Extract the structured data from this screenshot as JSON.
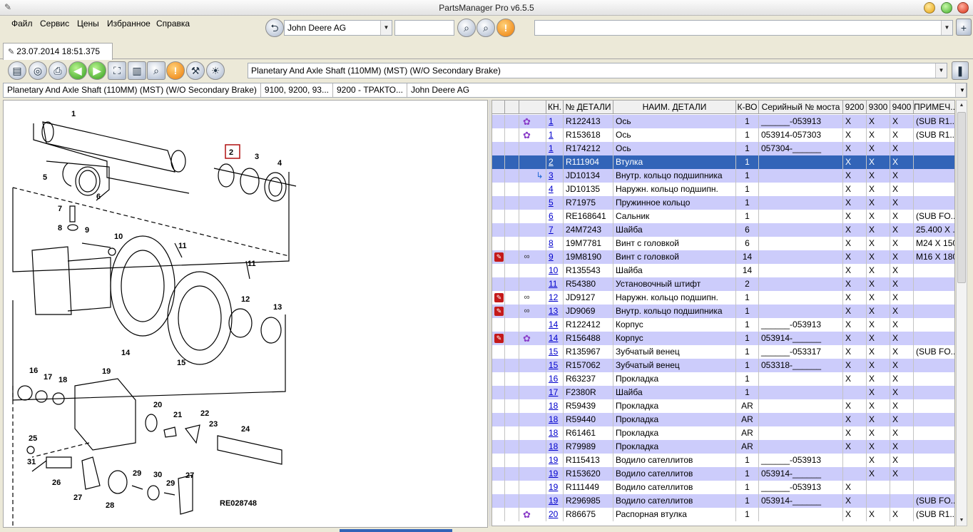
{
  "window": {
    "title": "PartsManager Pro v6.5.5"
  },
  "menu": [
    "Файл",
    "Сервис",
    "Цены",
    "Избранное",
    "Справка"
  ],
  "toolbar": {
    "brand_select": "John Deere AG",
    "search_value": "",
    "filter_value": ""
  },
  "tab": {
    "label": "23.07.2014 18:51.375"
  },
  "section_select": "Planetary And Axle Shaft (110MM) (MST) (W/O Secondary Brake)",
  "breadcrumb": [
    "Planetary And Axle Shaft (110MM) (MST) (W/O Secondary Brake)",
    "9100, 9200, 93...",
    "9200 - ТРАКТО...",
    "John Deere AG"
  ],
  "diagram": {
    "code": "RE028748",
    "highlighted": "2",
    "callouts": [
      "1",
      "2",
      "3",
      "4",
      "5",
      "6",
      "7",
      "8",
      "9",
      "10",
      "11",
      "11",
      "12",
      "13",
      "14",
      "15",
      "16",
      "17",
      "18",
      "19",
      "20",
      "21",
      "22",
      "23",
      "24",
      "25",
      "26",
      "27",
      "27",
      "28",
      "29",
      "29",
      "30",
      "31"
    ]
  },
  "colors": {
    "selection": "#3264b8",
    "alt_row": "#ccccfb",
    "link": "#0000cc",
    "flag": "#c41a1a",
    "gear": "#8a3cc8"
  },
  "grid": {
    "headers": [
      "КН.",
      "№ ДЕТАЛИ",
      "НАИМ. ДЕТАЛИ",
      "К-ВО",
      "Серийный № моста",
      "9200",
      "9300",
      "9400",
      "ПРИМЕЧ..."
    ],
    "rows": [
      {
        "icons": [
          "",
          "gear-icon"
        ],
        "kn": "1",
        "num": "R122413",
        "name": "Ось",
        "qty": "1",
        "serial": "______-053913",
        "c9200": "X",
        "c9300": "X",
        "c9400": "X",
        "note": "(SUB R1..."
      },
      {
        "icons": [
          "",
          "gear-icon"
        ],
        "kn": "1",
        "num": "R153618",
        "name": "Ось",
        "qty": "1",
        "serial": "053914-057303",
        "c9200": "X",
        "c9300": "X",
        "c9400": "X",
        "note": "(SUB R1..."
      },
      {
        "icons": [
          "",
          ""
        ],
        "kn": "1",
        "num": "R174212",
        "name": "Ось",
        "qty": "1",
        "serial": "057304-______",
        "c9200": "X",
        "c9300": "X",
        "c9400": "X",
        "note": ""
      },
      {
        "icons": [
          "",
          ""
        ],
        "kn": "2",
        "num": "R111904",
        "name": "Втулка",
        "qty": "1",
        "serial": "",
        "c9200": "X",
        "c9300": "X",
        "c9400": "X",
        "note": ""
      },
      {
        "icons": [
          "",
          "arrow-icon"
        ],
        "kn": "3",
        "num": "JD10134",
        "name": "Внутр. кольцо подшипника",
        "qty": "1",
        "serial": "",
        "c9200": "X",
        "c9300": "X",
        "c9400": "X",
        "note": ""
      },
      {
        "icons": [
          "",
          ""
        ],
        "kn": "4",
        "num": "JD10135",
        "name": "Наружн. кольцо подшипн.",
        "qty": "1",
        "serial": "",
        "c9200": "X",
        "c9300": "X",
        "c9400": "X",
        "note": ""
      },
      {
        "icons": [
          "",
          ""
        ],
        "kn": "5",
        "num": "R71975",
        "name": "Пружинное кольцо",
        "qty": "1",
        "serial": "",
        "c9200": "X",
        "c9300": "X",
        "c9400": "X",
        "note": ""
      },
      {
        "icons": [
          "",
          ""
        ],
        "kn": "6",
        "num": "RE168641",
        "name": "Сальник",
        "qty": "1",
        "serial": "",
        "c9200": "X",
        "c9300": "X",
        "c9400": "X",
        "note": "(SUB FO..."
      },
      {
        "icons": [
          "",
          ""
        ],
        "kn": "7",
        "num": "24M7243",
        "name": "Шайба",
        "qty": "6",
        "serial": "",
        "c9200": "X",
        "c9300": "X",
        "c9400": "X",
        "note": "25.400 X ..."
      },
      {
        "icons": [
          "",
          ""
        ],
        "kn": "8",
        "num": "19M7781",
        "name": "Винт с головкой",
        "qty": "6",
        "serial": "",
        "c9200": "X",
        "c9300": "X",
        "c9400": "X",
        "note": "M24 X 150"
      },
      {
        "icons": [
          "flag-icon",
          "link-icon"
        ],
        "kn": "9",
        "num": "19M8190",
        "name": "Винт с головкой",
        "qty": "14",
        "serial": "",
        "c9200": "X",
        "c9300": "X",
        "c9400": "X",
        "note": "M16 X 180"
      },
      {
        "icons": [
          "",
          ""
        ],
        "kn": "10",
        "num": "R135543",
        "name": "Шайба",
        "qty": "14",
        "serial": "",
        "c9200": "X",
        "c9300": "X",
        "c9400": "X",
        "note": ""
      },
      {
        "icons": [
          "",
          ""
        ],
        "kn": "11",
        "num": "R54380",
        "name": "Установочный штифт",
        "qty": "2",
        "serial": "",
        "c9200": "X",
        "c9300": "X",
        "c9400": "X",
        "note": ""
      },
      {
        "icons": [
          "flag-icon",
          "link-icon"
        ],
        "kn": "12",
        "num": "JD9127",
        "name": "Наружн. кольцо подшипн.",
        "qty": "1",
        "serial": "",
        "c9200": "X",
        "c9300": "X",
        "c9400": "X",
        "note": ""
      },
      {
        "icons": [
          "flag-icon",
          "link-icon"
        ],
        "kn": "13",
        "num": "JD9069",
        "name": "Внутр. кольцо подшипника",
        "qty": "1",
        "serial": "",
        "c9200": "X",
        "c9300": "X",
        "c9400": "X",
        "note": ""
      },
      {
        "icons": [
          "",
          ""
        ],
        "kn": "14",
        "num": "R122412",
        "name": "Корпус",
        "qty": "1",
        "serial": "______-053913",
        "c9200": "X",
        "c9300": "X",
        "c9400": "X",
        "note": ""
      },
      {
        "icons": [
          "flag-icon",
          "gear-icon"
        ],
        "kn": "14",
        "num": "R156488",
        "name": "Корпус",
        "qty": "1",
        "serial": "053914-______",
        "c9200": "X",
        "c9300": "X",
        "c9400": "X",
        "note": ""
      },
      {
        "icons": [
          "",
          ""
        ],
        "kn": "15",
        "num": "R135967",
        "name": "Зубчатый венец",
        "qty": "1",
        "serial": "______-053317",
        "c9200": "X",
        "c9300": "X",
        "c9400": "X",
        "note": "(SUB FO..."
      },
      {
        "icons": [
          "",
          ""
        ],
        "kn": "15",
        "num": "R157062",
        "name": "Зубчатый венец",
        "qty": "1",
        "serial": "053318-______",
        "c9200": "X",
        "c9300": "X",
        "c9400": "X",
        "note": ""
      },
      {
        "icons": [
          "",
          ""
        ],
        "kn": "16",
        "num": "R63237",
        "name": "Прокладка",
        "qty": "1",
        "serial": "",
        "c9200": "X",
        "c9300": "X",
        "c9400": "X",
        "note": ""
      },
      {
        "icons": [
          "",
          ""
        ],
        "kn": "17",
        "num": "F2380R",
        "name": "Шайба",
        "qty": "1",
        "serial": "",
        "c9200": "",
        "c9300": "X",
        "c9400": "X",
        "note": ""
      },
      {
        "icons": [
          "",
          ""
        ],
        "kn": "18",
        "num": "R59439",
        "name": "Прокладка",
        "qty": "AR",
        "serial": "",
        "c9200": "X",
        "c9300": "X",
        "c9400": "X",
        "note": ""
      },
      {
        "icons": [
          "",
          ""
        ],
        "kn": "18",
        "num": "R59440",
        "name": "Прокладка",
        "qty": "AR",
        "serial": "",
        "c9200": "X",
        "c9300": "X",
        "c9400": "X",
        "note": ""
      },
      {
        "icons": [
          "",
          ""
        ],
        "kn": "18",
        "num": "R61461",
        "name": "Прокладка",
        "qty": "AR",
        "serial": "",
        "c9200": "X",
        "c9300": "X",
        "c9400": "X",
        "note": ""
      },
      {
        "icons": [
          "",
          ""
        ],
        "kn": "18",
        "num": "R79989",
        "name": "Прокладка",
        "qty": "AR",
        "serial": "",
        "c9200": "X",
        "c9300": "X",
        "c9400": "X",
        "note": ""
      },
      {
        "icons": [
          "",
          ""
        ],
        "kn": "19",
        "num": "R115413",
        "name": "Водило сателлитов",
        "qty": "1",
        "serial": "______-053913",
        "c9200": "",
        "c9300": "X",
        "c9400": "X",
        "note": ""
      },
      {
        "icons": [
          "",
          ""
        ],
        "kn": "19",
        "num": "R153620",
        "name": "Водило сателлитов",
        "qty": "1",
        "serial": "053914-______",
        "c9200": "",
        "c9300": "X",
        "c9400": "X",
        "note": ""
      },
      {
        "icons": [
          "",
          ""
        ],
        "kn": "19",
        "num": "R111449",
        "name": "Водило сателлитов",
        "qty": "1",
        "serial": "______-053913",
        "c9200": "X",
        "c9300": "",
        "c9400": "",
        "note": ""
      },
      {
        "icons": [
          "",
          ""
        ],
        "kn": "19",
        "num": "R296985",
        "name": "Водило сателлитов",
        "qty": "1",
        "serial": "053914-______",
        "c9200": "X",
        "c9300": "",
        "c9400": "",
        "note": "(SUB FO..."
      },
      {
        "icons": [
          "",
          "gear-icon"
        ],
        "kn": "20",
        "num": "R86675",
        "name": "Распорная втулка",
        "qty": "1",
        "serial": "",
        "c9200": "X",
        "c9300": "X",
        "c9400": "X",
        "note": "(SUB R1..."
      }
    ]
  }
}
